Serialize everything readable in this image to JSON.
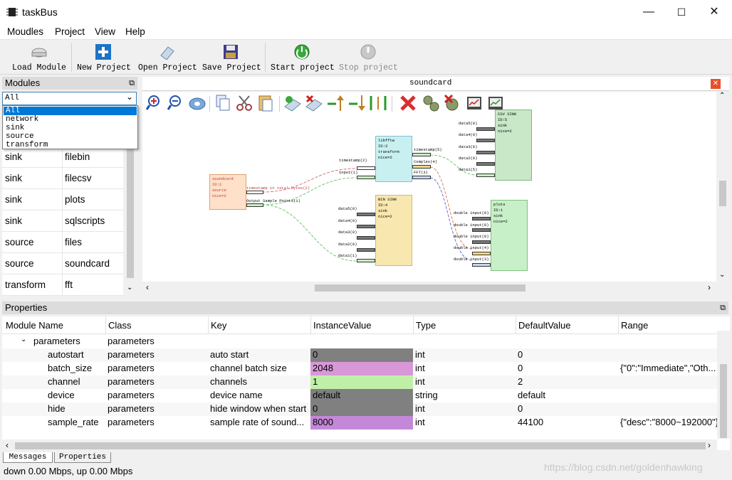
{
  "window": {
    "title": "taskBus",
    "min_glyph": "—",
    "max_glyph": "☐",
    "close_glyph": "✕"
  },
  "menubar": [
    "Moudles",
    "Project",
    "View",
    "Help"
  ],
  "toolbar": {
    "load_module": "Load Module",
    "new_project": "New Project",
    "open_project": "Open Project",
    "save_project": "Save Project",
    "start_project": "Start project",
    "stop_project": "Stop project"
  },
  "modules_panel": {
    "title": "Modules",
    "combo_value": "All",
    "dropdown_options": [
      "All",
      "network",
      "sink",
      "source",
      "transform"
    ],
    "rows": [
      {
        "type": "sink",
        "name": "filebin"
      },
      {
        "type": "sink",
        "name": "filecsv"
      },
      {
        "type": "sink",
        "name": "plots"
      },
      {
        "type": "sink",
        "name": "sqlscripts"
      },
      {
        "type": "source",
        "name": "files"
      },
      {
        "type": "source",
        "name": "soundcard"
      },
      {
        "type": "transform",
        "name": "fft"
      }
    ]
  },
  "canvas": {
    "tab_title": "soundcard",
    "blocks": {
      "soundcard": [
        "soundcard",
        "ID:2",
        "source",
        "nice=2"
      ],
      "libfftw": [
        "libfftw",
        "ID:3",
        "transform",
        "nice=2"
      ],
      "bin_sink": [
        "BIN SINK",
        "ID:4",
        "sink",
        "nice=2"
      ],
      "csv_sink": [
        "CSV SINK",
        "ID:5",
        "sink",
        "nice=2"
      ],
      "plots": [
        "plots",
        "ID:1",
        "sink",
        "nice=2"
      ]
    },
    "port_labels": {
      "sc_out1": "timestamp in total bytes(2)",
      "sc_out2": "Output Sample Points(1)",
      "fft_in1": "timestamp(2)",
      "fft_in2": "input(1)",
      "fft_out1": "timestamp(5)",
      "fft_out2": "Complex(4)",
      "fft_out3": "FFT(3)",
      "bin_in": [
        "data5(0)",
        "data4(0)",
        "data3(0)",
        "data2(0)",
        "data1(1)"
      ],
      "csv_in": [
        "data5(0)",
        "data4(0)",
        "data3(0)",
        "data2(0)",
        "data1(5)"
      ],
      "plots_in": [
        "double  input(0)",
        "double  input(0)",
        "double  input(0)",
        "double  input(4)",
        "double  input(3)"
      ]
    }
  },
  "properties": {
    "title": "Properties",
    "columns": [
      "Module Name",
      "Class",
      "Key",
      "InstanceValue",
      "Type",
      "DefaultValue",
      "Range"
    ],
    "group": {
      "name": "parameters",
      "class": "parameters"
    },
    "rows": [
      {
        "name": "autostart",
        "class": "parameters",
        "key": "auto start",
        "value": "0",
        "type": "int",
        "default": "0",
        "range": "",
        "color": "#808080"
      },
      {
        "name": "batch_size",
        "class": "parameters",
        "key": "channel batch size",
        "value": "2048",
        "type": "int",
        "default": "0",
        "range": "{\"0\":\"Immediate\",\"Oth...",
        "color": "#d898d8"
      },
      {
        "name": "channel",
        "class": "parameters",
        "key": "channels",
        "value": "1",
        "type": "int",
        "default": "2",
        "range": "",
        "color": "#c0f0a8"
      },
      {
        "name": "device",
        "class": "parameters",
        "key": "device name",
        "value": "default",
        "type": "string",
        "default": "default",
        "range": "",
        "color": "#808080"
      },
      {
        "name": "hide",
        "class": "parameters",
        "key": "hide window when start",
        "value": "0",
        "type": "int",
        "default": "0",
        "range": "",
        "color": "#808080"
      },
      {
        "name": "sample_rate",
        "class": "parameters",
        "key": "sample rate of sound...",
        "value": "8000",
        "type": "int",
        "default": "44100",
        "range": "{\"desc\":\"8000~192000\"}",
        "color": "#c488d8"
      }
    ]
  },
  "bottom_tabs": [
    "Messages",
    "Properties"
  ],
  "status": "down 0.00 Mbps, up 0.00 Mbps",
  "watermark": "https://blog.csdn.net/goldenhawking"
}
